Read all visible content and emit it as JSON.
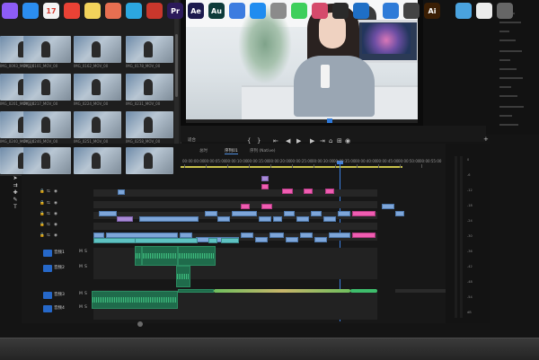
{
  "media_browser": {
    "clip_names": [
      "IMG_0093_MOV_00",
      "IMG_0101_MOV_00",
      "IMG_0162_MOV_00",
      "IMG_0178_MOV_00",
      "IMG_0201_MOV_00",
      "IMG_0217_MOV_00",
      "IMG_0224_MOV_00",
      "IMG_0231_MOV_00",
      "IMG_0240_MOV_00",
      "IMG_0246_MOV_00",
      "IMG_0251_MOV_00",
      "IMG_0258_MOV_00",
      "IMG_0263_MOV_00",
      "IMG_0271_MOV_00",
      "IMG_0280_MOV_00",
      "IMG_0294_MOV_00"
    ]
  },
  "program_monitor": {
    "timecode": "00:02:06:17",
    "fit_label": "适合",
    "side_info": [
      "",
      "",
      "",
      "",
      "",
      "",
      "",
      "",
      "",
      "",
      "",
      "",
      "",
      ""
    ]
  },
  "transport": {
    "buttons": [
      "{",
      "}",
      "⇤",
      "◀",
      "▶",
      "▶",
      "⇥"
    ],
    "left_timecode": "适合"
  },
  "timeline": {
    "tabs": [
      "总时",
      "序列01",
      "序列 (Native)"
    ],
    "active_tab": 1,
    "ruler_labels": [
      "00:00:00:00",
      "00:00:05:00",
      "00:00:10:00",
      "00:00:15:00",
      "00:00:20:00",
      "00:00:25:00",
      "00:00:30:00",
      "00:00:35:00",
      "00:00:40:00",
      "00:00:45:00",
      "00:00:50:00",
      "00:00:55:00"
    ],
    "track_labels": [
      "V4",
      "V3",
      "V2",
      "V1",
      "A1",
      "A2",
      "A3",
      "A4"
    ],
    "audio_sublabels": [
      "音频1",
      "音频2",
      "音频3",
      "音频4"
    ]
  },
  "meters": {
    "scale": [
      "0",
      "-6",
      "-12",
      "-18",
      "-24",
      "-30",
      "-36",
      "-42",
      "-48",
      "-54",
      "dB"
    ]
  },
  "dock": {
    "apps": [
      {
        "icon": "siri-icon",
        "text": "",
        "color": "#8d5cf6"
      },
      {
        "icon": "safari-icon",
        "text": "",
        "color": "#2b8ef0"
      },
      {
        "icon": "calendar-icon",
        "text": "17",
        "color": "#f4f4f4"
      },
      {
        "icon": "chrome-icon",
        "text": "",
        "color": "#e94235"
      },
      {
        "icon": "notes-icon",
        "text": "",
        "color": "#f2d35b"
      },
      {
        "icon": "photos-icon",
        "text": "",
        "color": "#e76f51"
      },
      {
        "icon": "wechat-icon",
        "text": "",
        "color": "#2ca7e0"
      },
      {
        "icon": "game-icon",
        "text": "",
        "color": "#c9372c"
      },
      {
        "icon": "premiere-icon",
        "text": "Pr",
        "color": "#2c1a5a"
      },
      {
        "icon": "aftereffects-icon",
        "text": "Ae",
        "color": "#1c1a4e"
      },
      {
        "icon": "audition-icon",
        "text": "Au",
        "color": "#0e3b3a"
      },
      {
        "icon": "baidunetdisk-icon",
        "text": "",
        "color": "#3c7ce0"
      },
      {
        "icon": "appstore-icon",
        "text": "",
        "color": "#1f8cf0"
      },
      {
        "icon": "preferences-icon",
        "text": "",
        "color": "#8b8b8b"
      },
      {
        "icon": "wechat-icon-2",
        "text": "",
        "color": "#3ecf5c"
      },
      {
        "icon": "finalcut-icon",
        "text": "",
        "color": "#d54a6b"
      },
      {
        "icon": "compressor-icon",
        "text": "",
        "color": "#2a2a2a"
      },
      {
        "icon": "paw-icon",
        "text": "",
        "color": "#1e6fc6"
      },
      {
        "icon": "feishu-icon",
        "text": "",
        "color": "#2e7bd8"
      },
      {
        "icon": "davinci-icon",
        "text": "",
        "color": "#444"
      },
      {
        "icon": "illustrator-icon",
        "text": "Ai",
        "color": "#3a1e04"
      },
      {
        "icon": "folder-icon",
        "text": "",
        "color": "#4aa3df"
      },
      {
        "icon": "mail-icon",
        "text": "",
        "color": "#ececec"
      },
      {
        "icon": "screenshot-icon",
        "text": "",
        "color": "#666"
      }
    ]
  },
  "colors": {
    "accent_blue": "#2f79d8",
    "clip_blue": "#7ea6d9",
    "clip_pink": "#f05db1",
    "audio_green": "#1f6b4b"
  }
}
